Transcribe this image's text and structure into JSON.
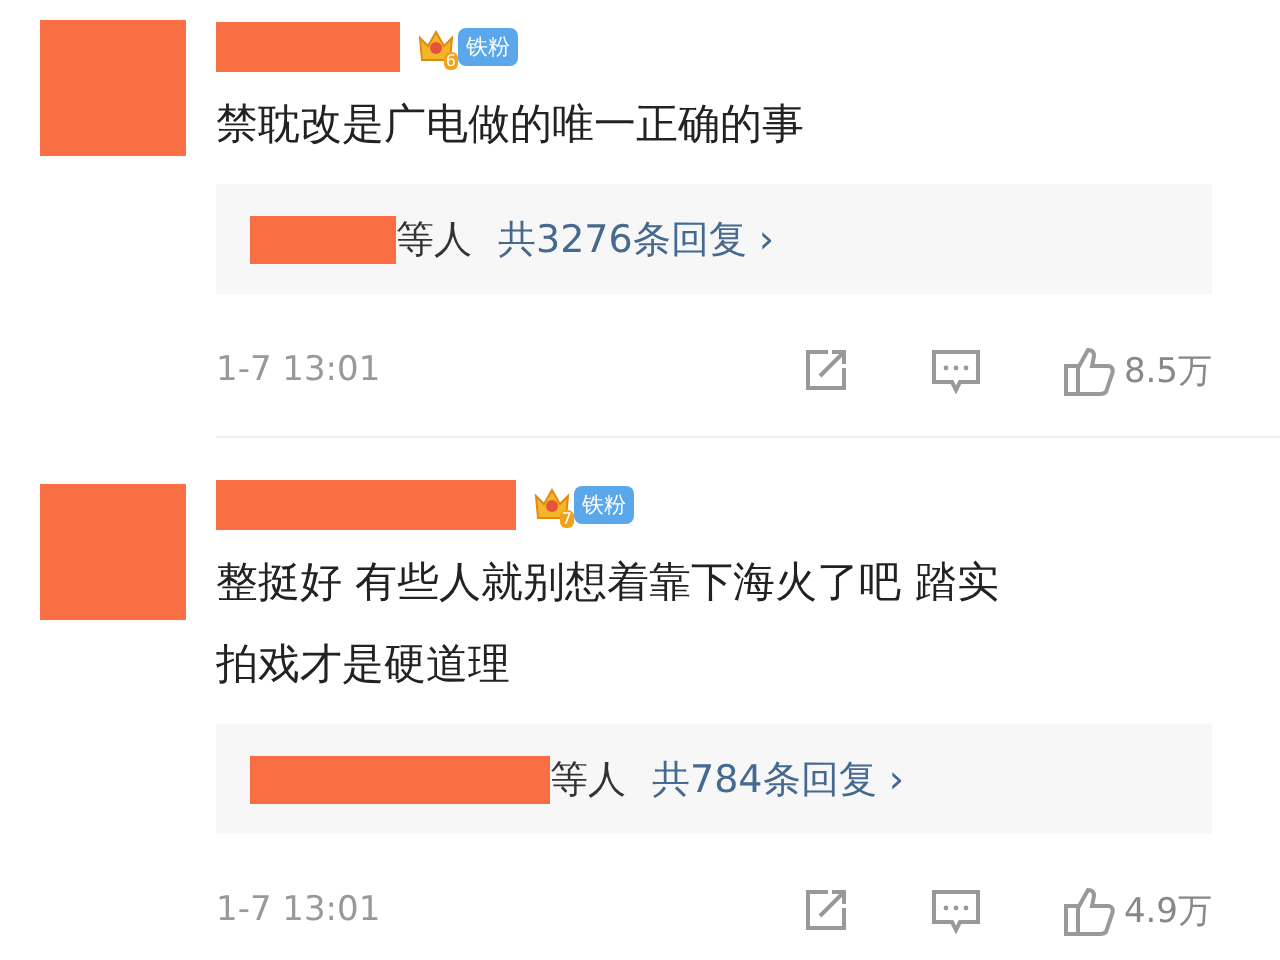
{
  "comments": [
    {
      "badge": {
        "level": "6",
        "label": "铁粉"
      },
      "text": "禁耽改是广电做的唯一正确的事",
      "replies": {
        "suffix": "等人",
        "count": "共3276条回复",
        "arrow": "›"
      },
      "time": "1-7 13:01",
      "likes": "8.5万"
    },
    {
      "badge": {
        "level": "7",
        "label": "铁粉"
      },
      "text": "整挺好 有些人就别想着靠下海火了吧 踏实拍戏才是硬道理",
      "replies": {
        "suffix": "等人",
        "count": "共784条回复",
        "arrow": "›"
      },
      "time": "1-7 13:01",
      "likes": "4.9万"
    }
  ]
}
